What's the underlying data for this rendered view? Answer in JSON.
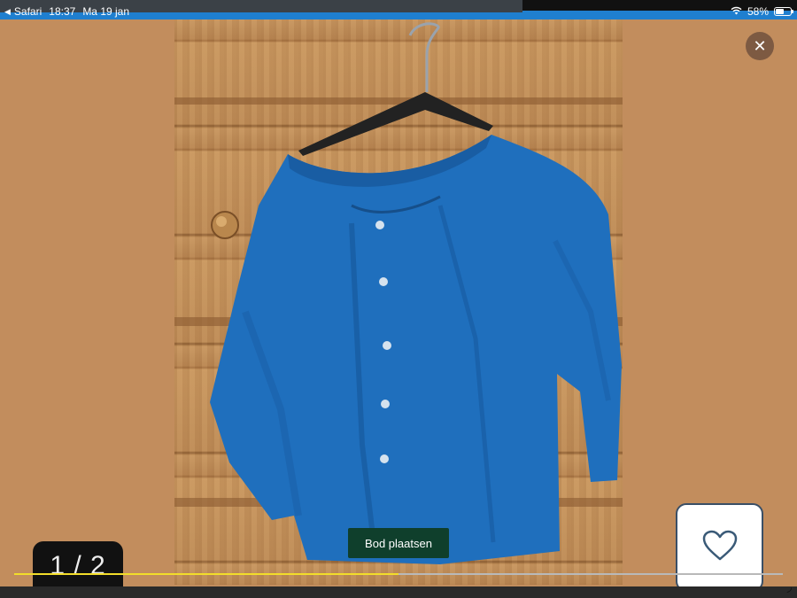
{
  "theme": {
    "background": "#c28d5d",
    "accent": "#0f3f2c",
    "progress": "#f2dd2a"
  },
  "status_bar": {
    "app": "Safari",
    "time": "18:37",
    "date": "Ma 19 jan",
    "battery": "58%",
    "battery_level": 0.58
  },
  "gallery": {
    "counter": "1 / 2",
    "progress": 0.5
  },
  "actions": {
    "bid_label": "Bod plaatsen"
  },
  "icons": {
    "close": "close-icon",
    "favorite": "heart-icon",
    "wifi": "wifi-icon",
    "battery": "battery-icon",
    "back": "back-arrow-icon"
  }
}
